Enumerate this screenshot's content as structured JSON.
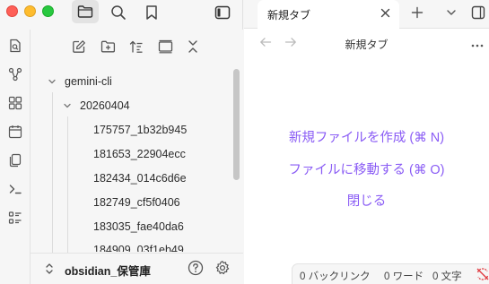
{
  "window": {
    "traffic_lights": [
      "close",
      "minimize",
      "zoom"
    ]
  },
  "sidebar_top_buttons": [
    {
      "name": "files-icon",
      "active": true
    },
    {
      "name": "search-icon",
      "active": false
    },
    {
      "name": "bookmark-icon",
      "active": false
    },
    {
      "name": "sidebar-toggle-icon",
      "active": false
    }
  ],
  "ribbon_icons": [
    "open-quick-switcher-icon",
    "graph-view-icon",
    "canvas-icon",
    "daily-note-icon",
    "templates-icon",
    "command-palette-icon",
    "bases-icon"
  ],
  "explorer_toolbar_icons": [
    "new-note-icon",
    "new-folder-icon",
    "sort-icon",
    "auto-reveal-icon",
    "collapse-all-icon"
  ],
  "file_tree": {
    "root_folder": "gemini-cli",
    "subfolder": "20260404",
    "files": [
      "175757_1b32b945",
      "181653_22904ecc",
      "182434_014c6d6e",
      "182749_cf5f0406",
      "183035_fae40da6",
      "184909_03f1eb49"
    ]
  },
  "vault": {
    "name": "obsidian_保管庫",
    "help_icon": "help-icon",
    "settings_icon": "gear-icon"
  },
  "tabs": [
    {
      "label": "新規タブ",
      "active": true
    }
  ],
  "view": {
    "title": "新規タブ",
    "actions": [
      "新規ファイルを作成 (⌘ N)",
      "ファイルに移動する (⌘ O)",
      "閉じる"
    ]
  },
  "status_bar": {
    "backlinks": "0 バックリンク",
    "words": "0 ワード",
    "chars": "0 文字"
  },
  "colors": {
    "accent": "#8a5cf5",
    "sidebar_bg": "#f6f6f6",
    "editor_bg": "#ffffff"
  }
}
